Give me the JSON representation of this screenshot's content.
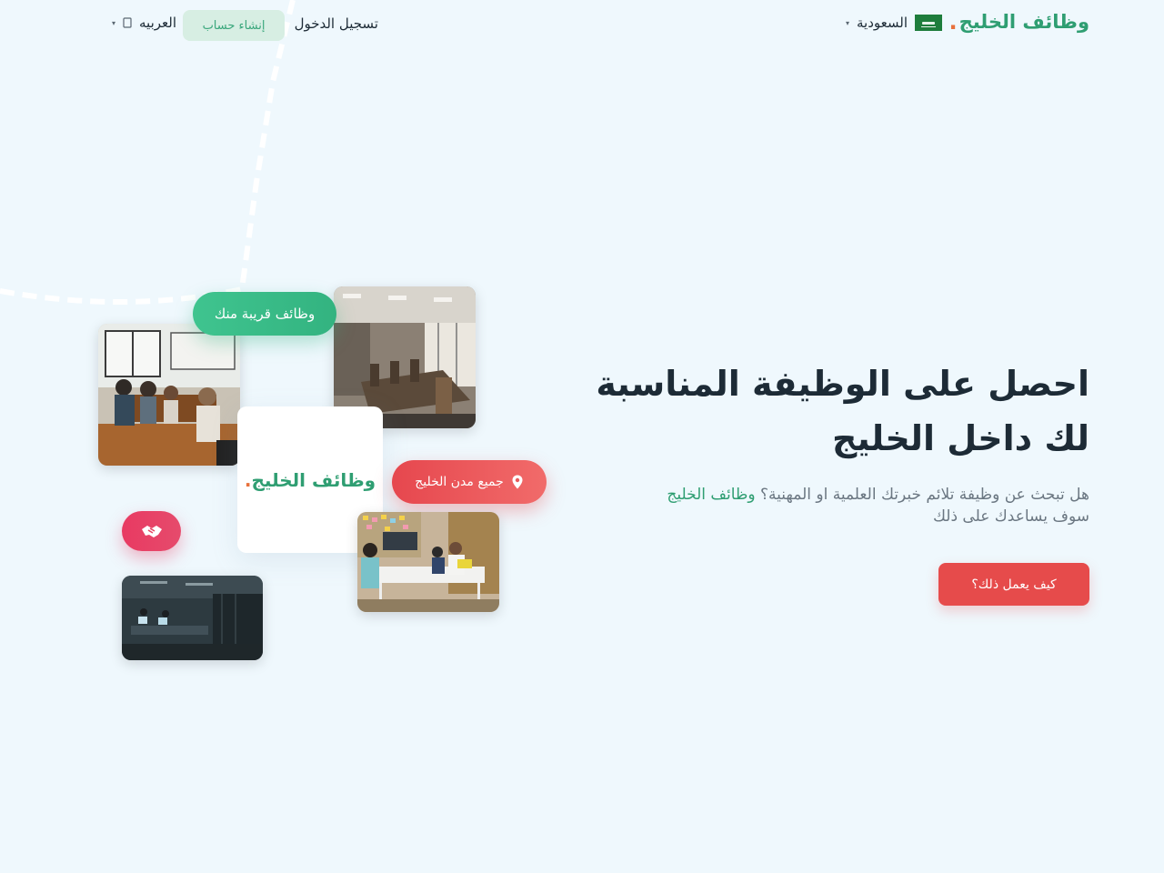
{
  "header": {
    "logo_text": "وظائف الخليج",
    "logo_dot": ".",
    "country_label": "السعودية",
    "country_caret": "▾",
    "login_label": "تسجيل الدخول",
    "signup_label": "إنشاء حساب",
    "language_label": "العربيه",
    "language_caret": "▾"
  },
  "hero": {
    "title_line1": "احصل على الوظيفة المناسبة",
    "title_line2": "لك داخل الخليج",
    "subtitle_part1": "هل تبحث عن وظيفة تلائم خبرتك العلمية او المهنية؟",
    "subtitle_highlight": "وظائف الخليج",
    "subtitle_part2": "سوف يساعدك على ذلك",
    "cta_label": "كيف يعمل ذلك؟"
  },
  "collage": {
    "center_card_text": "وظائف الخليج",
    "center_card_dot": ".",
    "nearby_jobs_label": "وظائف قريبة منك",
    "all_cities_label": "جميع مدن الخليج"
  },
  "colors": {
    "background": "#eff8fd",
    "brand_green": "#2f9e72",
    "accent_orange": "#e8713c",
    "cta_red": "#e64b4b",
    "text_dark": "#1d2b36",
    "text_muted": "#6b7782"
  },
  "icons": {
    "flag": "saudi-flag-icon",
    "globe": "globe-icon",
    "pin": "map-pin-icon",
    "handshake": "handshake-icon"
  }
}
